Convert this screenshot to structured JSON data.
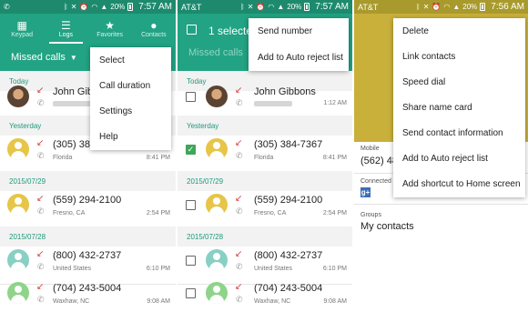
{
  "status": {
    "p1_time": "7:57 AM",
    "p2_carrier": "AT&T",
    "p2_time": "7:57 AM",
    "p3_carrier": "AT&T",
    "p3_time": "7:56 AM",
    "battery": "20%"
  },
  "tabs": [
    {
      "label": "Keypad",
      "icon": "keypad-icon",
      "glyph": "▦"
    },
    {
      "label": "Logs",
      "icon": "logs-icon",
      "glyph": "☰"
    },
    {
      "label": "Favorites",
      "icon": "star-icon",
      "glyph": "★"
    },
    {
      "label": "Contacts",
      "icon": "contact-icon",
      "glyph": "●"
    }
  ],
  "filter": {
    "label": "Missed calls"
  },
  "menu1": {
    "items": [
      "Select",
      "Call duration",
      "Settings",
      "Help"
    ]
  },
  "sections": {
    "today": "Today",
    "yesterday": "Yesterday",
    "d0729": "2015/07/29",
    "d0728": "2015/07/28"
  },
  "calls": [
    {
      "name": "John Gibbons",
      "name_p1": "John Gib",
      "sub": "",
      "time": "1:12 AM"
    },
    {
      "name": "(305) 384-7367",
      "name_p1": "(305) 384",
      "sub": "Florida",
      "time": "8:41 PM"
    },
    {
      "name": "(559) 294-2100",
      "name_p1": "(559) 294-2100",
      "sub": "Fresno, CA",
      "time": "2:54 PM"
    },
    {
      "name": "(800) 432-2737",
      "name_p1": "(800) 432-2737",
      "sub": "United States",
      "time": "6:10 PM"
    },
    {
      "name": "(704) 243-5004",
      "name_p1": "(704) 243-5004",
      "sub": "Waxhaw, NC",
      "time": "9:08 AM"
    }
  ],
  "selection": {
    "label": "1 selected",
    "label_visible": "1 selecte",
    "filter_dimmed": "Missed calls"
  },
  "menu2": {
    "items": [
      "Send number",
      "Add to Auto reject list"
    ]
  },
  "contact": {
    "mobile_label": "Mobile",
    "mobile_value": "(562) 481",
    "connected_label": "Connected vi",
    "connected_icon": "g+",
    "groups_label": "Groups",
    "groups_value": "My contacts",
    "banner_color": "#c9b03b"
  },
  "menu3": {
    "items": [
      "Delete",
      "Link contacts",
      "Speed dial",
      "Share name card",
      "Send contact information",
      "Add to Auto reject list",
      "Add shortcut to Home screen"
    ]
  },
  "colors": {
    "accent": "#22a383",
    "status": "#1d8a6e",
    "missed": "#d43b3b",
    "section_text": "#1d9a7a",
    "checked": "#3fa65a"
  }
}
